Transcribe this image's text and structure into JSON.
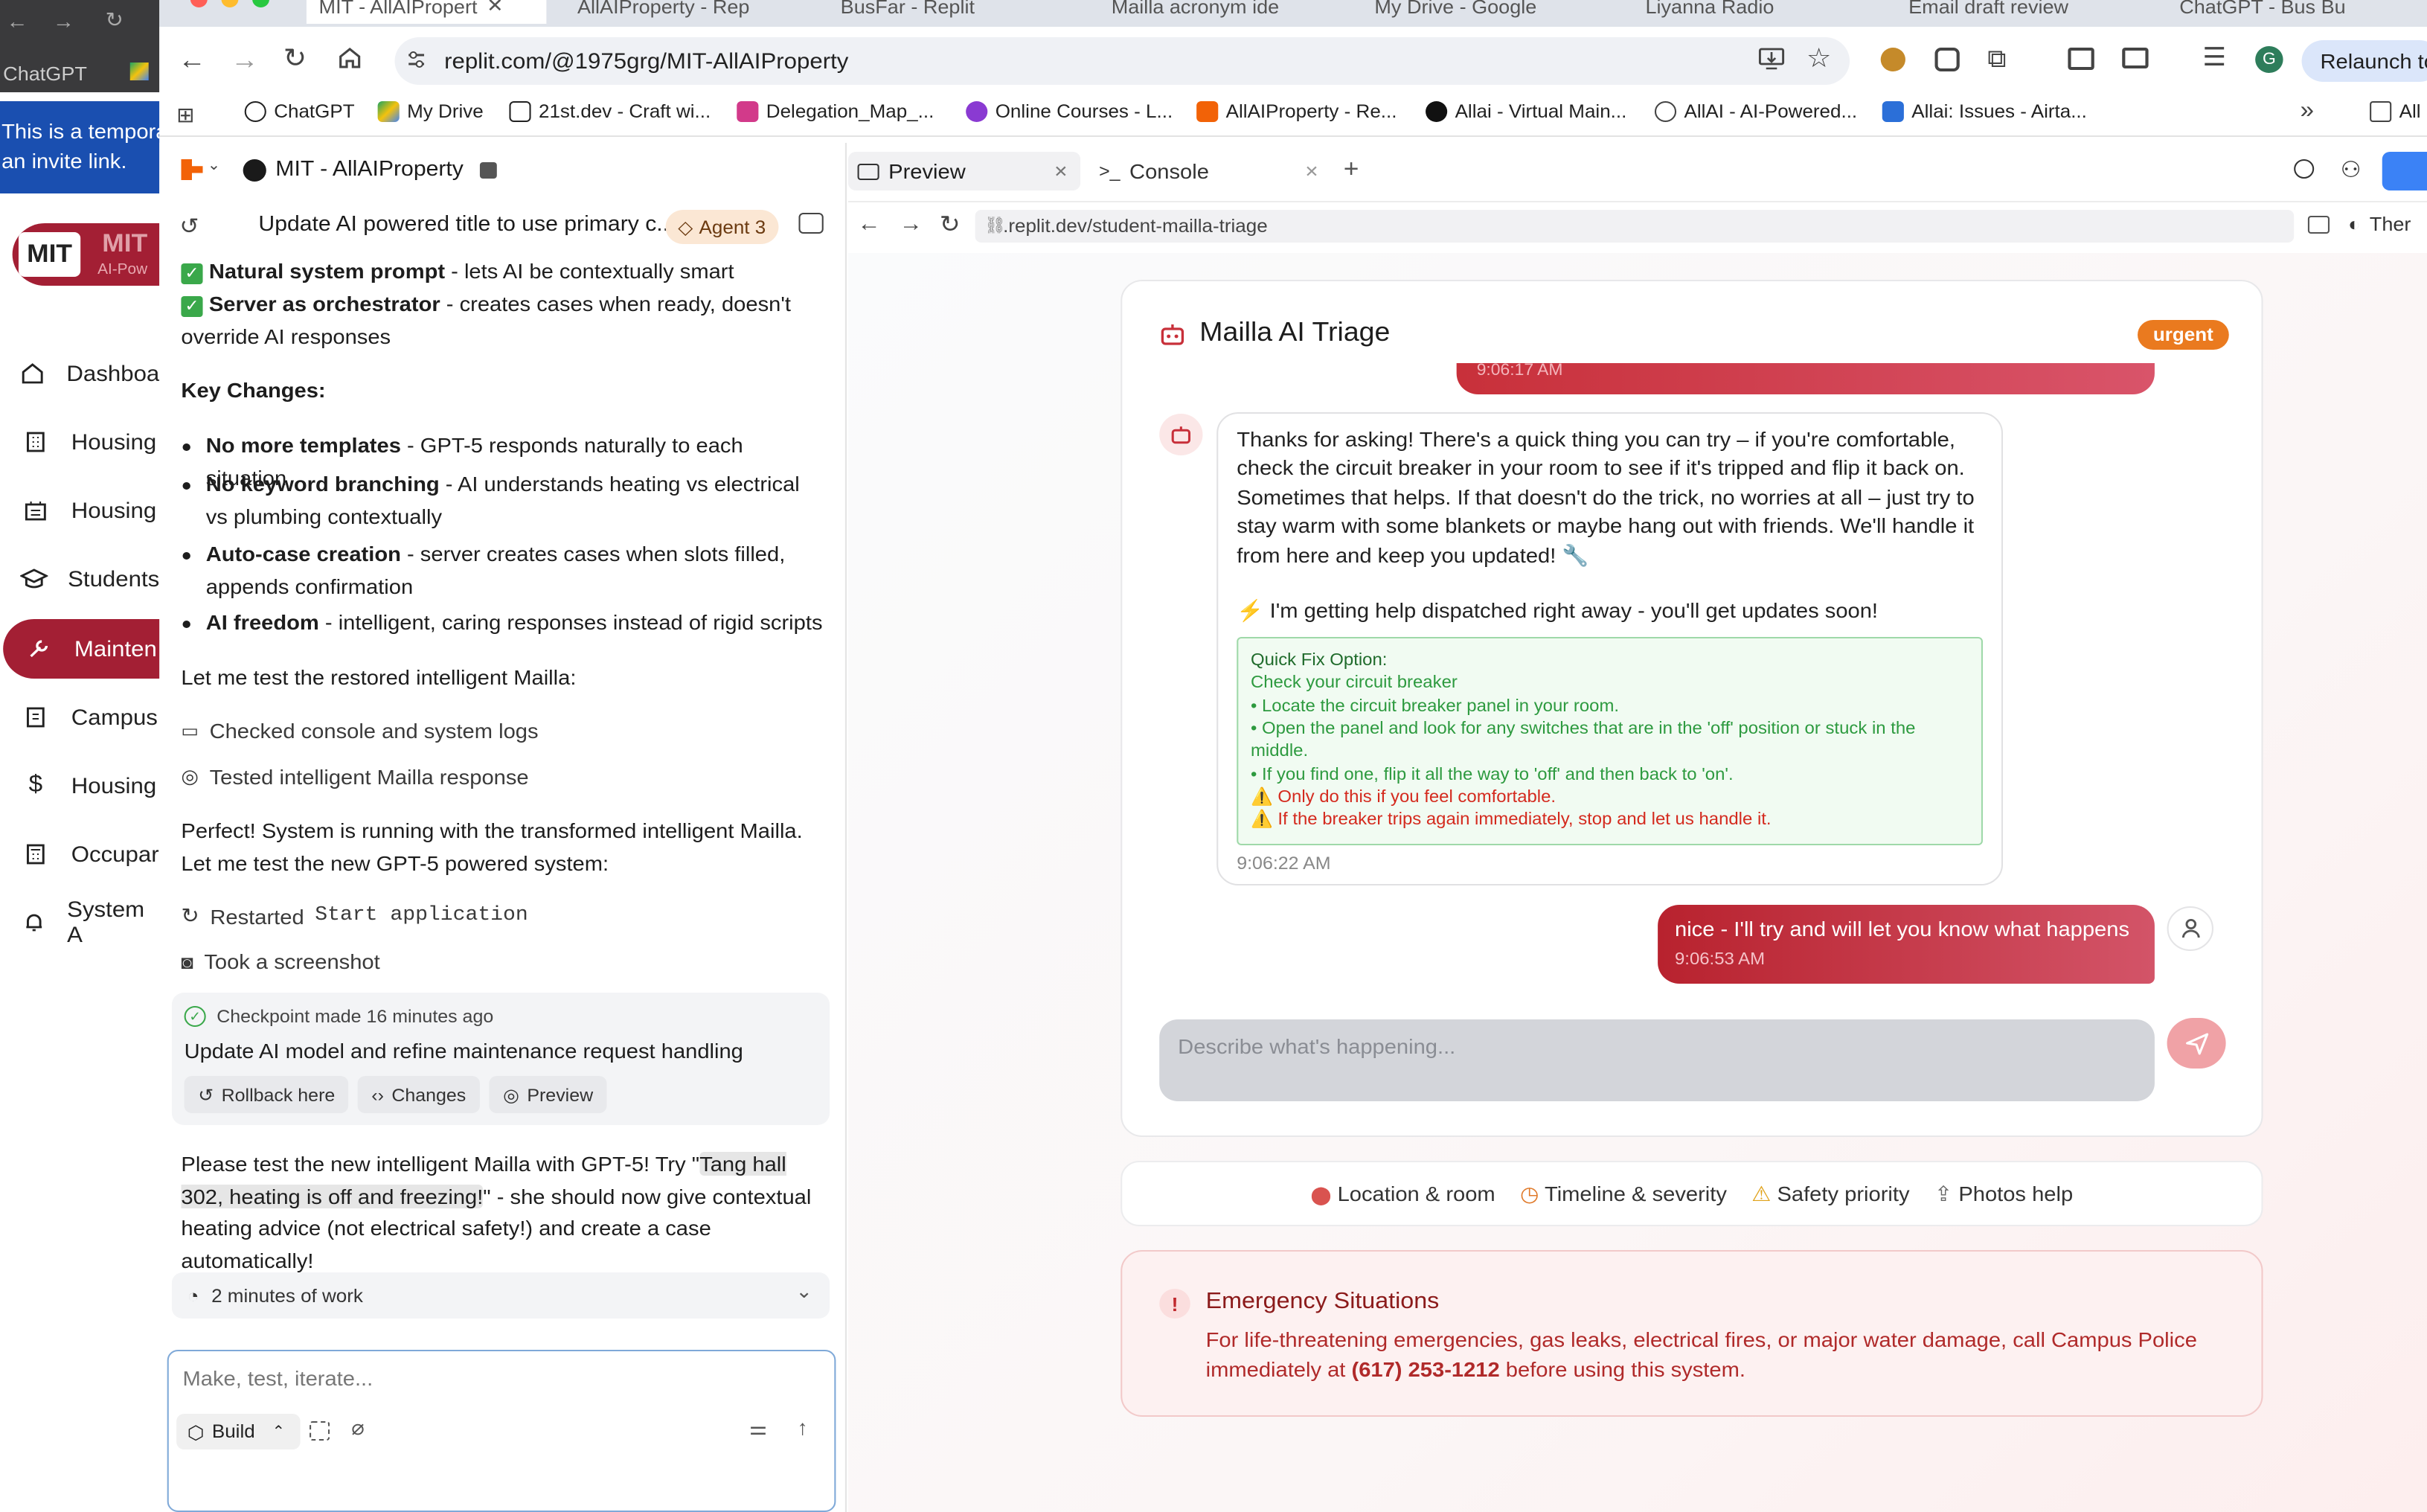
{
  "browser": {
    "tabs": [
      "MIT - AllAIPropert",
      "AllAIProperty - Rep",
      "BusFar - Replit",
      "Mailla acronym ide",
      "My Drive - Google",
      "Liyanna Radio",
      "Email draft review",
      "ChatGPT - Bus Bu"
    ],
    "url": "replit.com/@1975grg/MIT-AllAIProperty",
    "relaunch": "Relaunch to",
    "profile_initial": "G",
    "bookmarks": [
      "ChatGPT",
      "My Drive",
      "21st.dev - Craft wi...",
      "Delegation_Map_...",
      "Online Courses - L...",
      "AllAIProperty - Re...",
      "Allai - Virtual Main...",
      "AllAI - AI-Powered...",
      "Allai: Issues - Airta..."
    ],
    "all_bookmarks": "All"
  },
  "bg_window": {
    "tab": "ChatGPT",
    "notice_line1": "This is a tempora",
    "notice_line2": "an invite link.",
    "logo": "MIT",
    "logo2": "MIT",
    "logo_sub": "AI-Pow",
    "nav": [
      "Dashboa",
      "Housing",
      "Housing",
      "Students",
      "Mainten",
      "Campus",
      "Housing",
      "Occupar",
      "System A"
    ]
  },
  "replit": {
    "project": "MIT - AllAIProperty",
    "thread_title": "Update AI powered title to use primary c...",
    "agent_badge": "Agent 3",
    "lines": {
      "l1b": "Natural system prompt",
      "l1": " - lets AI be contextually smart",
      "l2b": "Server as orchestrator",
      "l2": " - creates cases when ready, doesn't override AI responses",
      "key": "Key Changes:",
      "b1b": "No more templates",
      "b1": " - GPT-5 responds naturally to each situation",
      "b2b": "No keyword branching",
      "b2": " - AI understands heating vs electrical vs plumbing contextually",
      "b3b": "Auto-case creation",
      "b3": " - server creates cases when slots filled, appends confirmation",
      "b4b": "AI freedom",
      "b4": " - intelligent, caring responses instead of rigid scripts",
      "p1": "Let me test the restored intelligent Mailla:",
      "a1": "Checked console and system logs",
      "a2": "Tested intelligent Mailla response",
      "p2": "Perfect! System is running with the transformed intelligent Mailla. Let me test the new GPT-5 powered system:",
      "a3": "Restarted",
      "a3m": "Start application",
      "a4": "Took a screenshot",
      "p3a": "Please test the new intelligent Mailla with GPT-5! Try \"",
      "p3h": "Tang hall 302, heating is off and freezing!",
      "p3b": "\" - she should now give contextual heating advice (not electrical safety!) and create a case automatically!"
    },
    "checkpoint": {
      "label": "Checkpoint made",
      "time": "16 minutes ago",
      "title": "Update AI model and refine maintenance request handling",
      "buttons": [
        "Rollback here",
        "Changes",
        "Preview"
      ]
    },
    "work": "2 minutes of work",
    "input_placeholder": "Make, test, iterate...",
    "build": "Build"
  },
  "preview": {
    "tabs": [
      "Preview",
      "Console"
    ],
    "url": ".replit.dev/student-mailla-triage",
    "theme": "Ther",
    "card_title": "Mailla AI Triage",
    "urgency": "urgent",
    "prev_time": "9:06:17 AM",
    "bot_message": "Thanks for asking! There's a quick thing you can try – if you're comfortable, check the circuit breaker in your room to see if it's tripped and flip it back on. Sometimes that helps. If that doesn't do the trick, no worries at all – just try to stay warm with some blankets or maybe hang out with friends. We'll handle it from here and keep you updated! 🔧",
    "dispatch": "⚡ I'm getting help dispatched right away - you'll get updates soon!",
    "quick_fix": {
      "title": "Quick Fix Option:",
      "subtitle": "Check your circuit breaker",
      "steps": [
        "• Locate the circuit breaker panel in your room.",
        "• Open the panel and look for any switches that are in the 'off' position or stuck in the",
        "middle.",
        "• If you find one, flip it all the way to 'off' and then back to 'on'."
      ],
      "warnings": [
        "⚠️ Only do this if you feel comfortable.",
        "⚠️ If the breaker trips again immediately, stop and let us handle it."
      ]
    },
    "bot_time": "9:06:22 AM",
    "user_message": "nice - I'll try and will let you know what happens",
    "user_time": "9:06:53 AM",
    "input_placeholder": "Describe what's happening...",
    "hints": [
      "Location & room",
      "Timeline & severity",
      "Safety priority",
      "Photos help"
    ],
    "emergency_title": "Emergency Situations",
    "emergency_text_a": "For life-threatening emergencies, gas leaks, electrical fires, or major water damage, call Campus Police immediately at ",
    "emergency_phone": "(617) 253-1212",
    "emergency_text_b": " before using this system."
  },
  "colors": {
    "accent": "#a31f34",
    "urgent": "#ea7a1f",
    "quickfix_green": "#2d9a3f",
    "warning_red": "#d42a1e"
  }
}
